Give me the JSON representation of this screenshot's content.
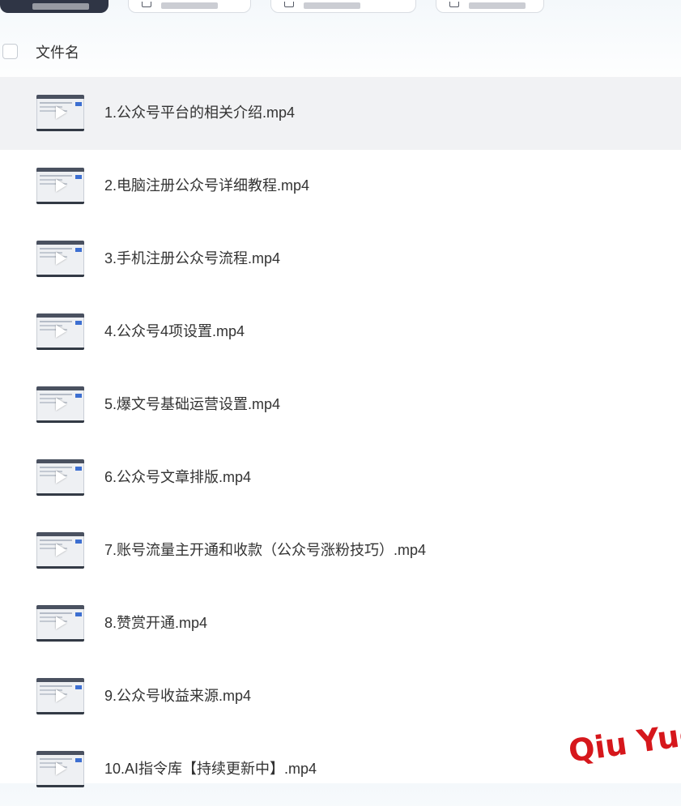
{
  "header": {
    "column_label": "文件名"
  },
  "files": [
    {
      "name": "1.公众号平台的相关介绍.mp4",
      "selected": true
    },
    {
      "name": "2.电脑注册公众号详细教程.mp4"
    },
    {
      "name": "3.手机注册公众号流程.mp4"
    },
    {
      "name": "4.公众号4项设置.mp4"
    },
    {
      "name": "5.爆文号基础运营设置.mp4"
    },
    {
      "name": "6.公众号文章排版.mp4"
    },
    {
      "name": "7.账号流量主开通和收款（公众号涨粉技巧）.mp4"
    },
    {
      "name": "8.赞赏开通.mp4"
    },
    {
      "name": "9.公众号收益来源.mp4"
    },
    {
      "name": "10.AI指令库【持续更新中】.mp4"
    }
  ],
  "watermark": {
    "text": "Qiu Yue",
    "color": "#d6171c"
  },
  "colors": {
    "selected_row": "#f1f2f4",
    "primary_button": "#2f3545"
  }
}
